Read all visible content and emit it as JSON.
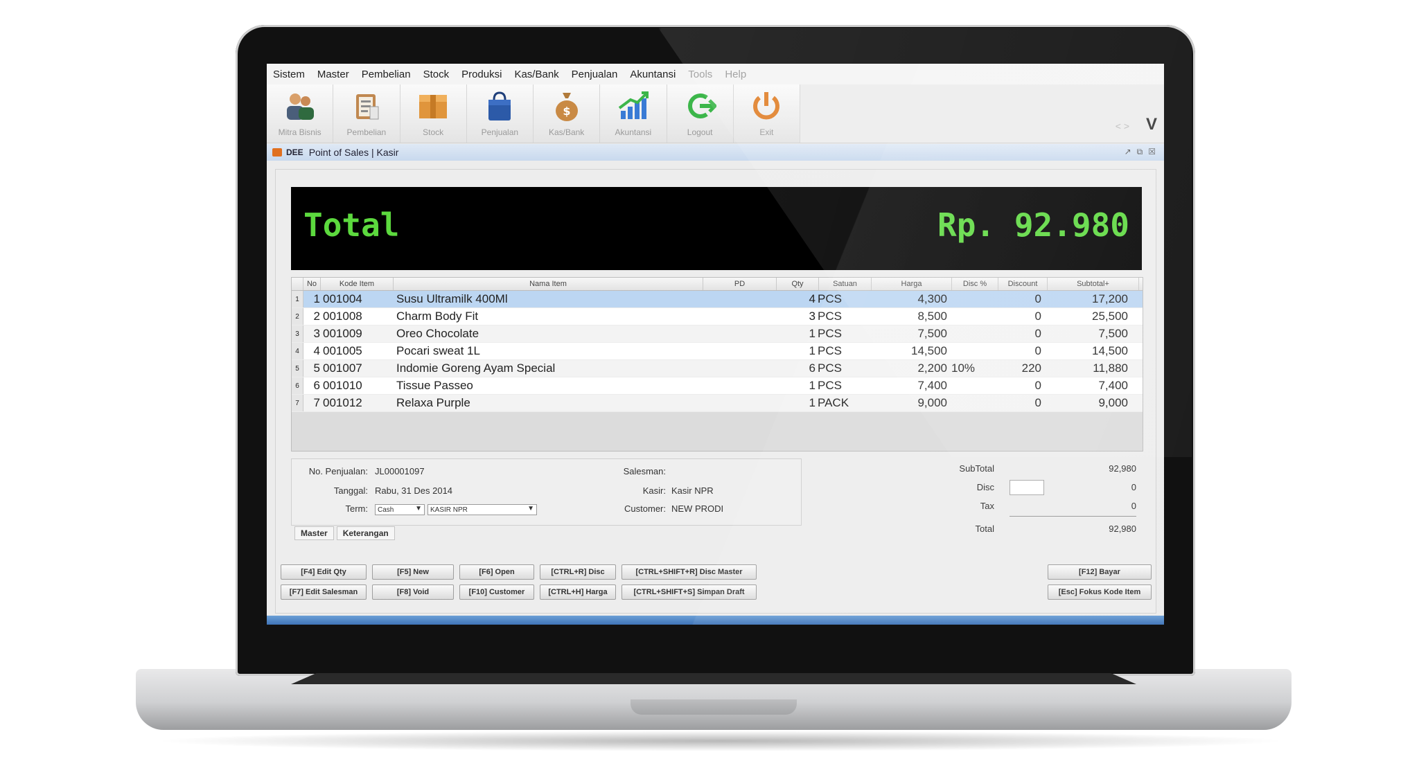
{
  "menu": [
    "Sistem",
    "Master",
    "Pembelian",
    "Stock",
    "Produksi",
    "Kas/Bank",
    "Penjualan",
    "Akuntansi",
    "Tools",
    "Help"
  ],
  "toolbar": [
    {
      "label": "Mitra Bisnis",
      "icon": "people-icon"
    },
    {
      "label": "Pembelian",
      "icon": "clipboard-icon"
    },
    {
      "label": "Stock",
      "icon": "box-icon"
    },
    {
      "label": "Penjualan",
      "icon": "shopping-bag-icon"
    },
    {
      "label": "Kas/Bank",
      "icon": "money-bag-icon"
    },
    {
      "label": "Akuntansi",
      "icon": "chart-icon"
    },
    {
      "label": "Logout",
      "icon": "logout-icon"
    },
    {
      "label": "Exit",
      "icon": "power-icon"
    }
  ],
  "toolbar_right": {
    "nav": "< >",
    "v": "V"
  },
  "window": {
    "brand": "DEE",
    "title": "Point of Sales | Kasir"
  },
  "total": {
    "label": "Total",
    "value": "Rp. 92.980"
  },
  "table": {
    "columns": [
      "No",
      "Kode Item",
      "Nama Item",
      "PD",
      "Qty",
      "Satuan",
      "Harga",
      "Disc %",
      "Discount",
      "Subtotal+"
    ],
    "rows": [
      {
        "idx": "1",
        "no": "1",
        "kode": "001004",
        "nama": "Susu Ultramilk 400Ml",
        "pd": "",
        "qty": "4",
        "satuan": "PCS",
        "harga": "4,300",
        "disc": "",
        "discount": "0",
        "subtotal": "17,200"
      },
      {
        "idx": "2",
        "no": "2",
        "kode": "001008",
        "nama": "Charm Body Fit",
        "pd": "",
        "qty": "3",
        "satuan": "PCS",
        "harga": "8,500",
        "disc": "",
        "discount": "0",
        "subtotal": "25,500"
      },
      {
        "idx": "3",
        "no": "3",
        "kode": "001009",
        "nama": "Oreo Chocolate",
        "pd": "",
        "qty": "1",
        "satuan": "PCS",
        "harga": "7,500",
        "disc": "",
        "discount": "0",
        "subtotal": "7,500"
      },
      {
        "idx": "4",
        "no": "4",
        "kode": "001005",
        "nama": "Pocari sweat 1L",
        "pd": "",
        "qty": "1",
        "satuan": "PCS",
        "harga": "14,500",
        "disc": "",
        "discount": "0",
        "subtotal": "14,500"
      },
      {
        "idx": "5",
        "no": "5",
        "kode": "001007",
        "nama": "Indomie Goreng Ayam Special",
        "pd": "",
        "qty": "6",
        "satuan": "PCS",
        "harga": "2,200",
        "disc": "10%",
        "discount": "220",
        "subtotal": "11,880"
      },
      {
        "idx": "6",
        "no": "6",
        "kode": "001010",
        "nama": "Tissue Passeo",
        "pd": "",
        "qty": "1",
        "satuan": "PCS",
        "harga": "7,400",
        "disc": "",
        "discount": "0",
        "subtotal": "7,400"
      },
      {
        "idx": "7",
        "no": "7",
        "kode": "001012",
        "nama": "Relaxa Purple",
        "pd": "",
        "qty": "1",
        "satuan": "PACK",
        "harga": "9,000",
        "disc": "",
        "discount": "0",
        "subtotal": "9,000"
      }
    ]
  },
  "form": {
    "no_penjualan_label": "No. Penjualan:",
    "no_penjualan": "JL00001097",
    "tanggal_label": "Tanggal:",
    "tanggal": "Rabu, 31 Des 2014",
    "term_label": "Term:",
    "term": "Cash",
    "kasir_select": "KASIR NPR",
    "salesman_label": "Salesman:",
    "salesman": "",
    "kasir_label": "Kasir:",
    "kasir": "Kasir NPR",
    "customer_label": "Customer:",
    "customer": "NEW PRODI"
  },
  "tabs": [
    "Master",
    "Keterangan"
  ],
  "summary": {
    "subtotal_label": "SubTotal",
    "subtotal": "92,980",
    "disc_label": "Disc",
    "disc": "0",
    "tax_label": "Tax",
    "tax": "0",
    "total_label": "Total",
    "total": "92,980"
  },
  "buttons": {
    "row1": [
      "[F4] Edit Qty",
      "[F5] New",
      "[F6] Open",
      "[CTRL+R] Disc",
      "[CTRL+SHIFT+R] Disc Master"
    ],
    "row2": [
      "[F7] Edit Salesman",
      "[F8] Void",
      "[F10] Customer",
      "[CTRL+H] Harga",
      "[CTRL+SHIFT+S] Simpan Draft"
    ],
    "bayar": "[F12] Bayar",
    "fokus": "[Esc] Fokus Kode Item"
  }
}
